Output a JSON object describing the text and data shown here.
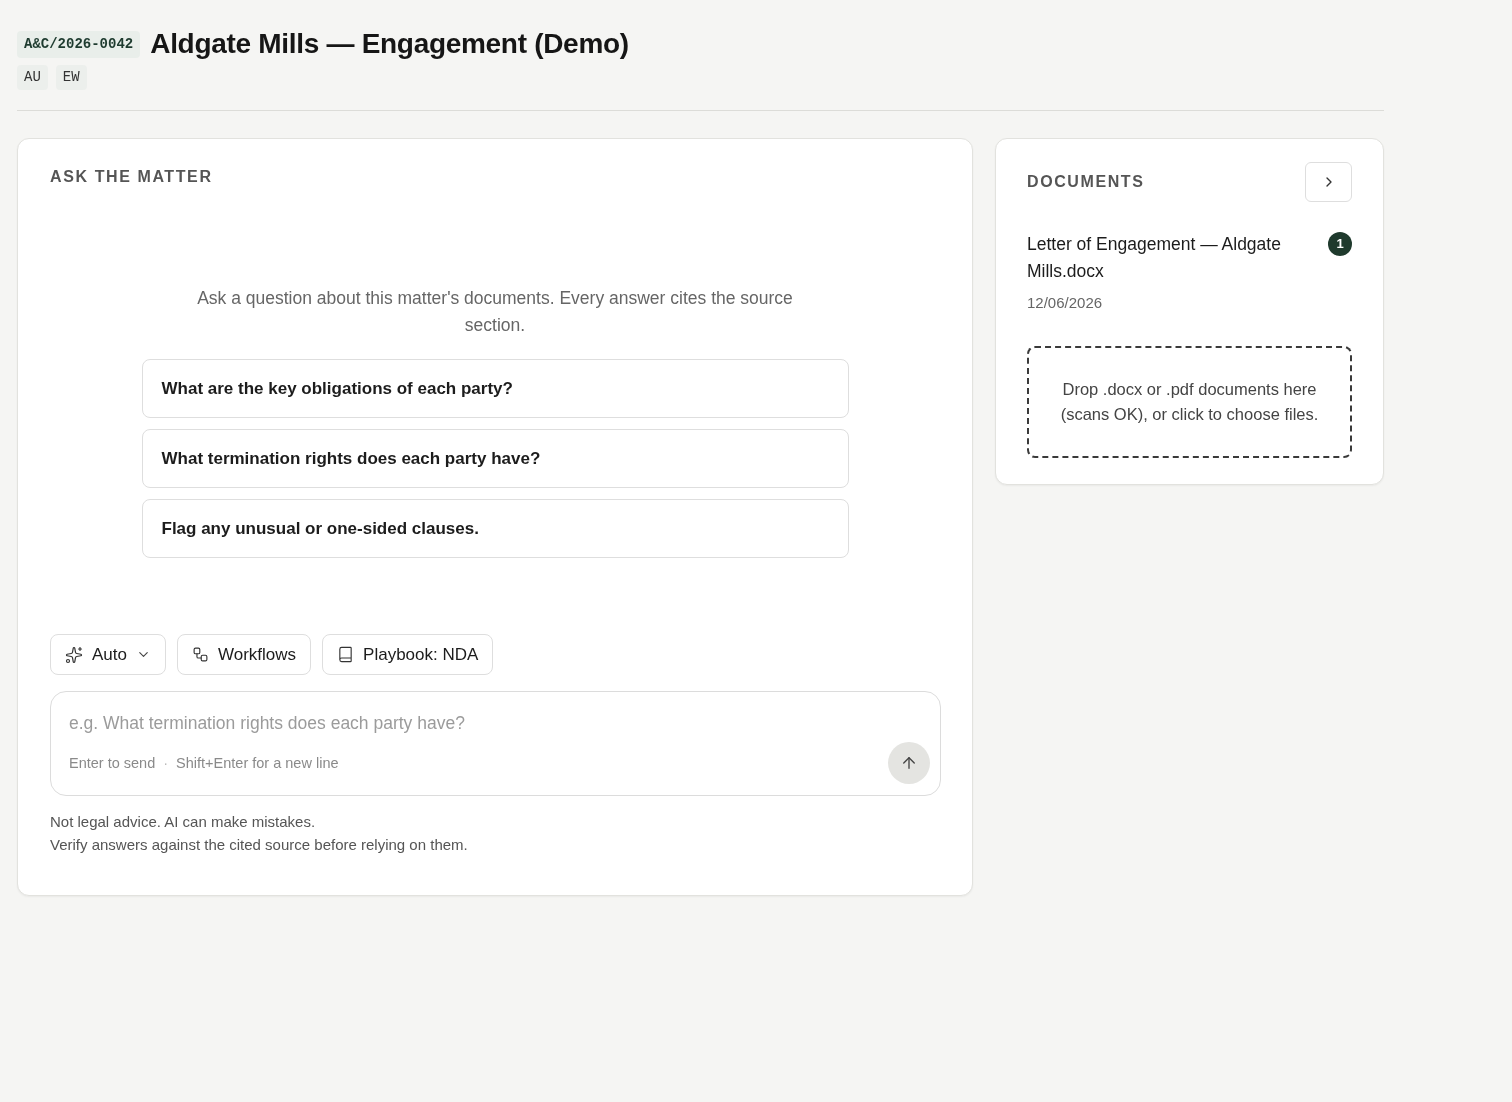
{
  "header": {
    "matter_id": "A&C/2026-0042",
    "title": "Aldgate Mills — Engagement (Demo)",
    "tags": [
      "AU",
      "EW"
    ]
  },
  "ask_panel": {
    "heading": "ASK THE MATTER",
    "intro": "Ask a question about this matter's documents. Every answer cites the source section.",
    "suggestions": [
      "What are the key obligations of each party?",
      "What termination rights does each party have?",
      "Flag any unusual or one-sided clauses."
    ],
    "toolbar": [
      {
        "kind": "mode",
        "label": "Auto"
      },
      {
        "kind": "workflows",
        "label": "Workflows"
      },
      {
        "kind": "playbook",
        "label": "Playbook: NDA"
      }
    ],
    "composer": {
      "placeholder": "e.g. What termination rights does each party have?",
      "hints": [
        "Enter to send",
        "Shift+Enter for a new line"
      ],
      "separator": "·"
    },
    "disclaimer": [
      "Not legal advice. AI can make mistakes.",
      "Verify answers against the cited source before relying on them."
    ]
  },
  "documents_panel": {
    "heading": "DOCUMENTS",
    "documents": [
      {
        "name": "Letter of Engagement — Aldgate Mills.docx",
        "badge": "1",
        "date": "12/06/2026"
      }
    ],
    "dropzone": "Drop .docx or .pdf documents here (scans OK), or click to choose files."
  }
}
